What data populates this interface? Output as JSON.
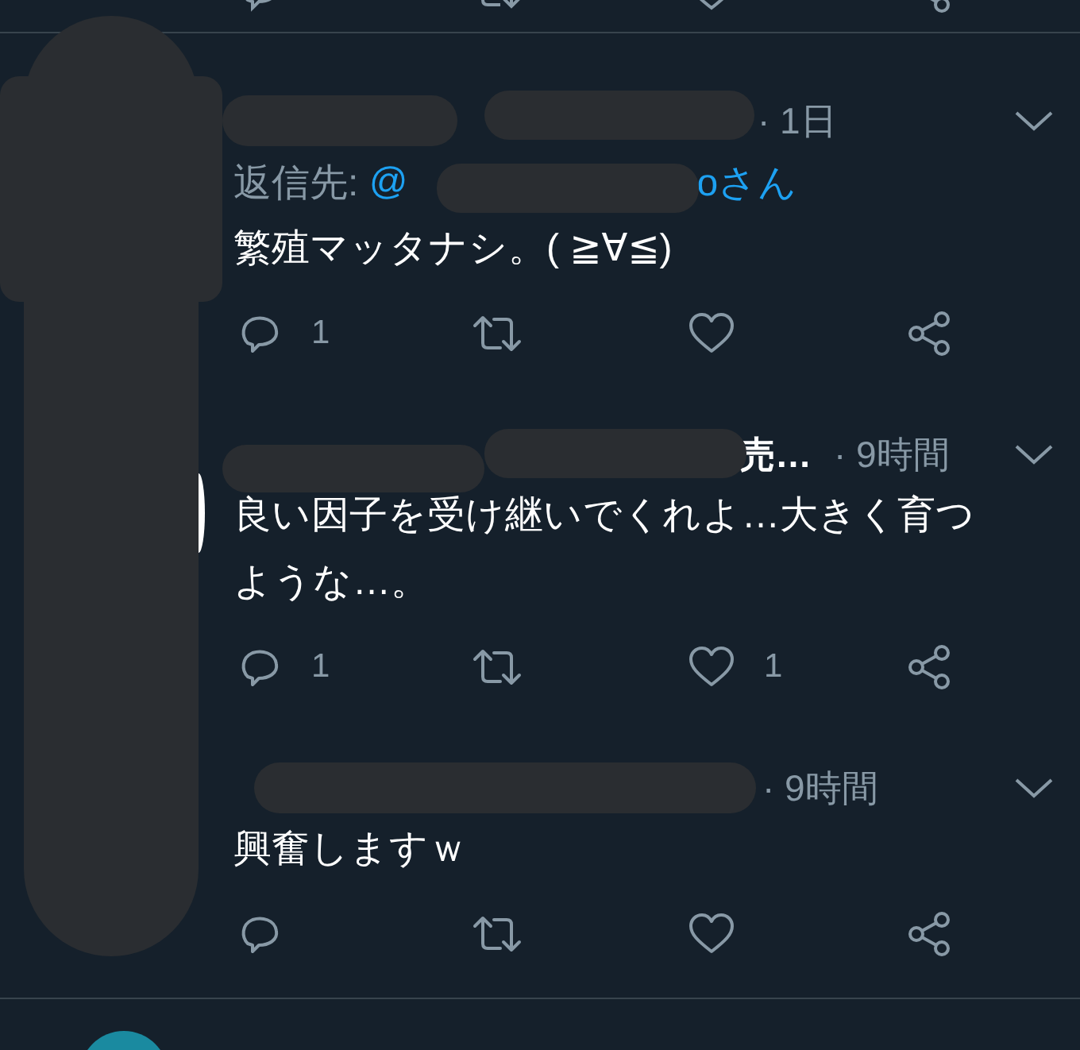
{
  "tweets": [
    {
      "time": "· 1日",
      "reply_prefix": "返信先: ",
      "reply_at": "@",
      "reply_suffix": "oさん",
      "text": "繁殖マッタナシ。( ≧∀≦)",
      "reply_count": "1"
    },
    {
      "name_fragment": "売…",
      "time": "· 9時間",
      "text": "良い因子を受け継いでくれよ…大きく育つような…。",
      "reply_count": "1",
      "like_count": "1"
    },
    {
      "time": "· 9時間",
      "text": "興奮しますｗ"
    }
  ]
}
